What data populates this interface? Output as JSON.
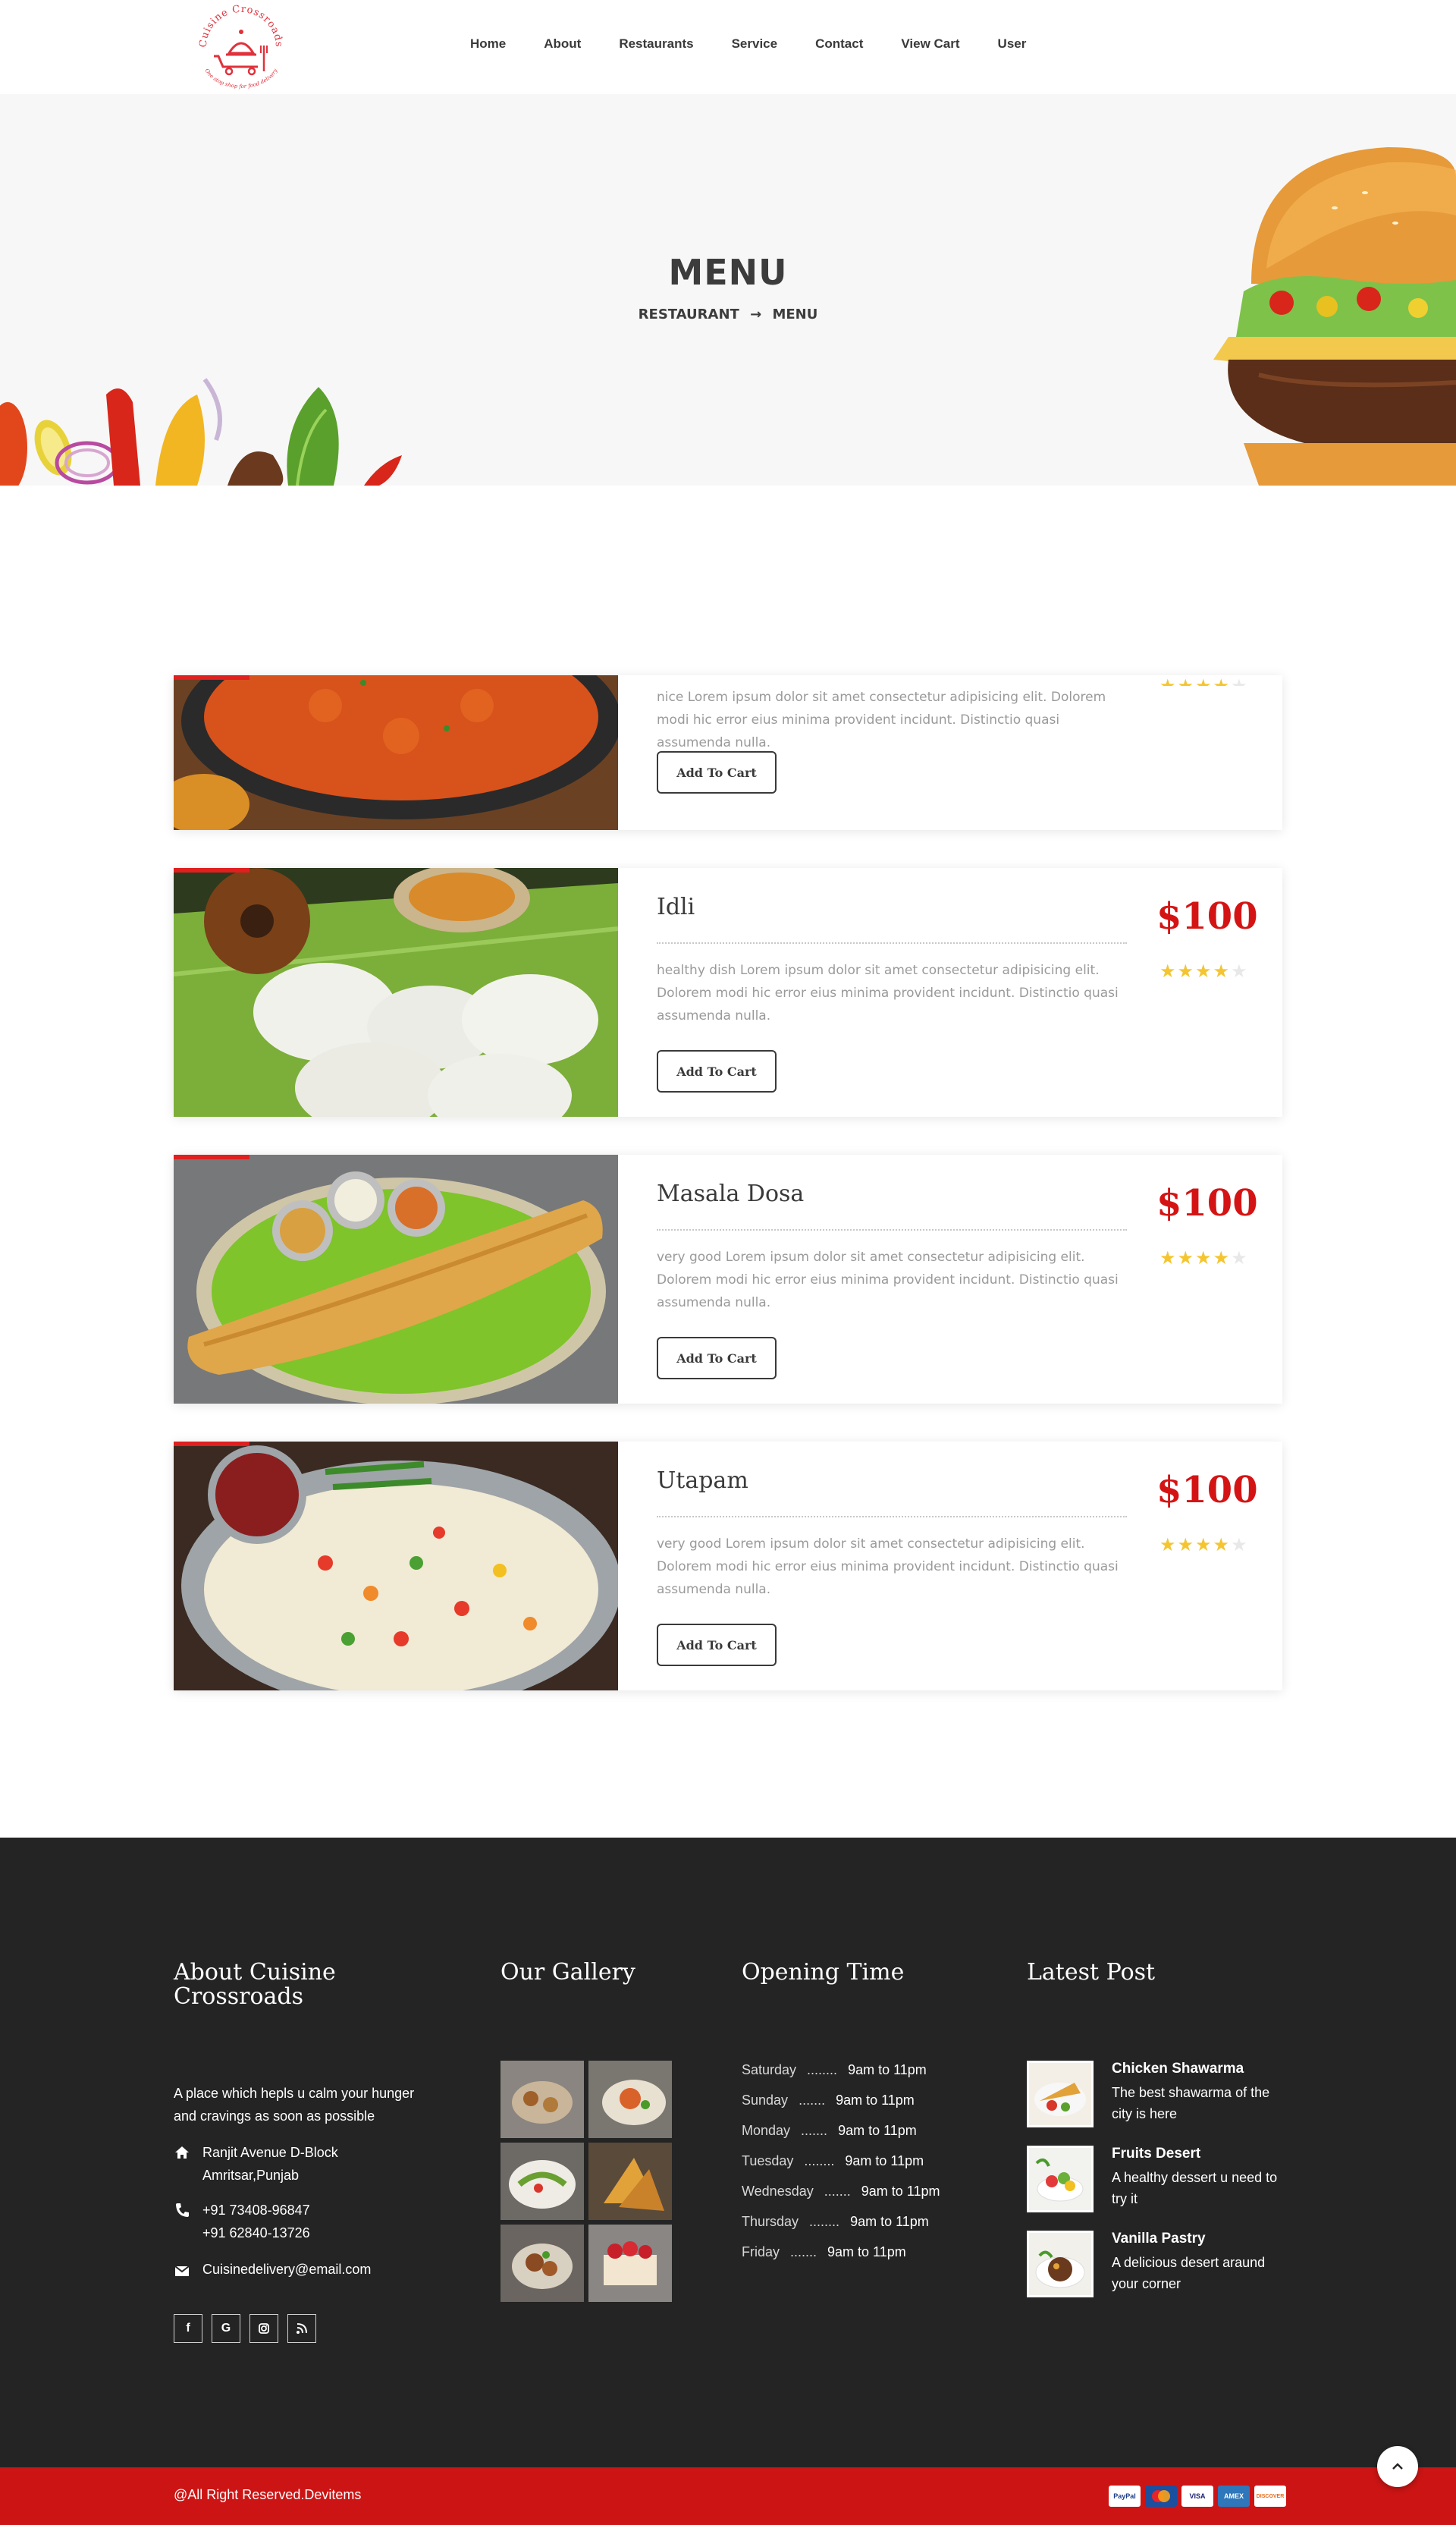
{
  "header": {
    "logo_text": "Cuisine Crossroads",
    "logo_tagline": "One stop shop for food delivery",
    "nav": [
      "Home",
      "About",
      "Restaurants",
      "Service",
      "Contact",
      "View Cart",
      "User"
    ]
  },
  "hero": {
    "title": "MENU",
    "breadcrumb": [
      "RESTAURANT",
      "→",
      "MENU"
    ]
  },
  "menu_items": [
    {
      "name": "",
      "price": "",
      "description": "nice Lorem ipsum dolor sit amet consectetur adipisicing elit. Dolorem modi hic error eius minima provident incidunt. Distinctio quasi assumenda nulla.",
      "button": "Add To Cart",
      "rating": 4
    },
    {
      "name": "Idli",
      "price": "$100",
      "description": "healthy dish Lorem ipsum dolor sit amet consectetur adipisicing elit. Dolorem modi hic error eius minima provident incidunt. Distinctio quasi assumenda nulla.",
      "button": "Add To Cart",
      "rating": 4
    },
    {
      "name": "Masala Dosa",
      "price": "$100",
      "description": "very good Lorem ipsum dolor sit amet consectetur adipisicing elit. Dolorem modi hic error eius minima provident incidunt. Distinctio quasi assumenda nulla.",
      "button": "Add To Cart",
      "rating": 4
    },
    {
      "name": "Utapam",
      "price": "$100",
      "description": "very good Lorem ipsum dolor sit amet consectetur adipisicing elit. Dolorem modi hic error eius minima provident incidunt. Distinctio quasi assumenda nulla.",
      "button": "Add To Cart",
      "rating": 4
    }
  ],
  "footer": {
    "about": {
      "title": "About Cuisine Crossroads",
      "text": "A place which hepls u calm your hunger and cravings as soon as possible",
      "address_line1": "Ranjit Avenue D-Block",
      "address_line2": "Amritsar,Punjab",
      "phone1": "+91 73408-96847",
      "phone2": "+91 62840-13726",
      "email": "Cuisinedelivery@email.com",
      "social": [
        "f",
        "G",
        "instagram-icon",
        "rss-icon"
      ]
    },
    "gallery": {
      "title": "Our Gallery"
    },
    "opening": {
      "title": "Opening Time",
      "rows": [
        {
          "day": "Saturday",
          "dots": "........",
          "time": "9am to 11pm"
        },
        {
          "day": "Sunday",
          "dots": ".......",
          "time": "9am to 11pm"
        },
        {
          "day": "Monday",
          "dots": ".......",
          "time": "9am to 11pm"
        },
        {
          "day": "Tuesday",
          "dots": "........",
          "time": "9am to 11pm"
        },
        {
          "day": "Wednesday",
          "dots": ".......",
          "time": "9am to 11pm"
        },
        {
          "day": "Thursday",
          "dots": "........",
          "time": "9am to 11pm"
        },
        {
          "day": "Friday",
          "dots": ".......",
          "time": "9am to 11pm"
        }
      ]
    },
    "posts": {
      "title": "Latest Post",
      "items": [
        {
          "title": "Chicken Shawarma",
          "desc": "The best shawarma of the city is here"
        },
        {
          "title": "Fruits Desert",
          "desc": "A healthy dessert u need to try it"
        },
        {
          "title": "Vanilla Pastry",
          "desc": "A delicious desert araund your corner"
        }
      ]
    },
    "copyright": "@All Right Reserved.Devitems",
    "payments": [
      "PayPal",
      "MC",
      "VISA",
      "AMEX",
      "DISCOVER"
    ]
  },
  "colors": {
    "accent": "#cc1414",
    "footer_bg": "#242424",
    "star": "#f4c531"
  }
}
